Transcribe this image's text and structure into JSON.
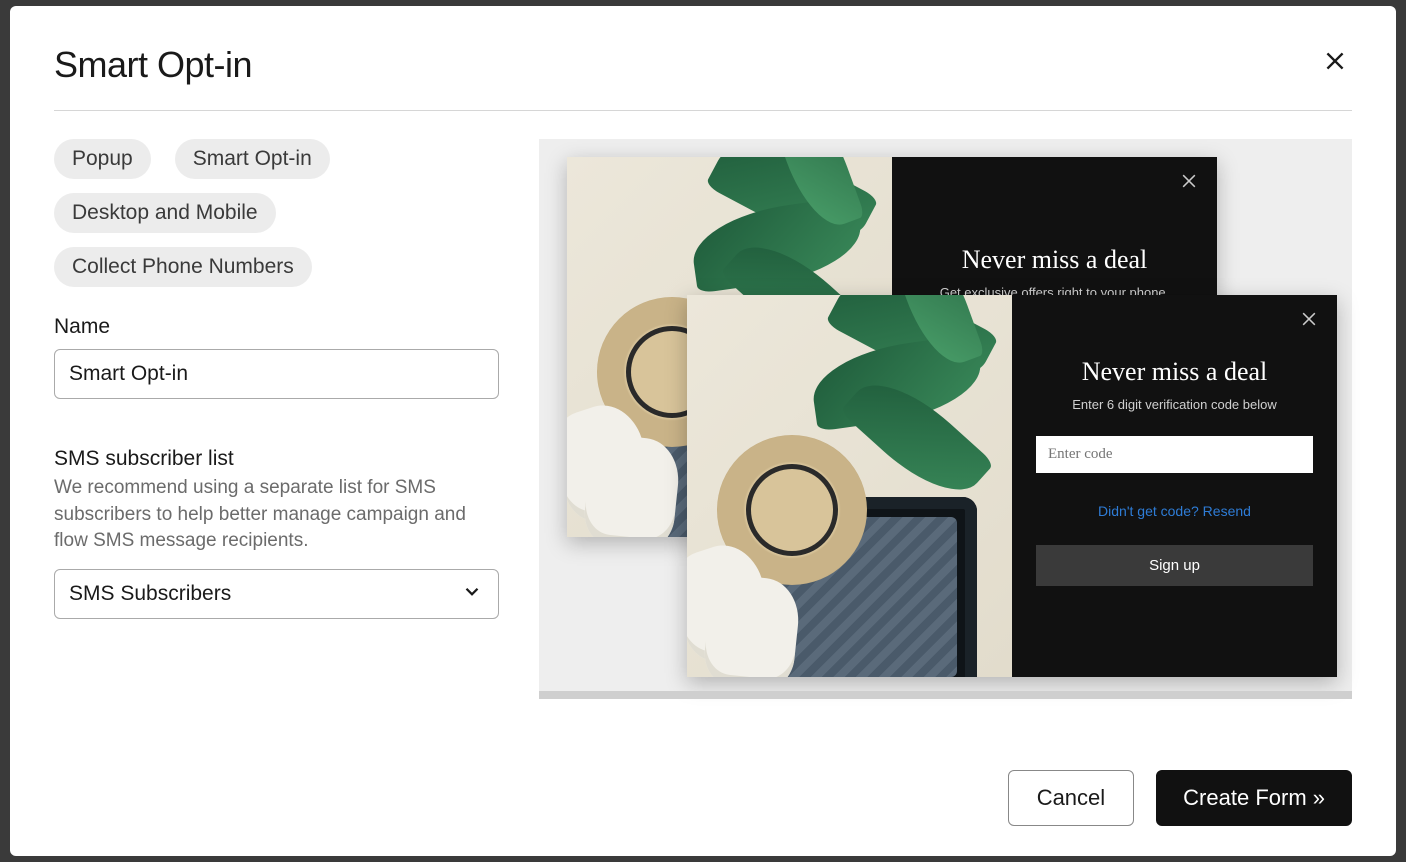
{
  "modal": {
    "title": "Smart Opt-in",
    "tags": [
      "Popup",
      "Smart Opt-in",
      "Desktop and Mobile",
      "Collect Phone Numbers"
    ],
    "name_field": {
      "label": "Name",
      "value": "Smart Opt-in"
    },
    "sms_section": {
      "title": "SMS subscriber list",
      "help": "We recommend using a separate list for SMS subscribers to help better manage campaign and flow SMS message recipients.",
      "selected": "SMS Subscribers"
    },
    "footer": {
      "cancel": "Cancel",
      "create": "Create Form »"
    }
  },
  "preview": {
    "back": {
      "title": "Never miss a deal",
      "subtitle": "Get exclusive offers right to your phone."
    },
    "front": {
      "title": "Never miss a deal",
      "subtitle": "Enter 6 digit verification code below",
      "input_placeholder": "Enter code",
      "resend": "Didn't get code? Resend",
      "signup": "Sign up"
    }
  }
}
